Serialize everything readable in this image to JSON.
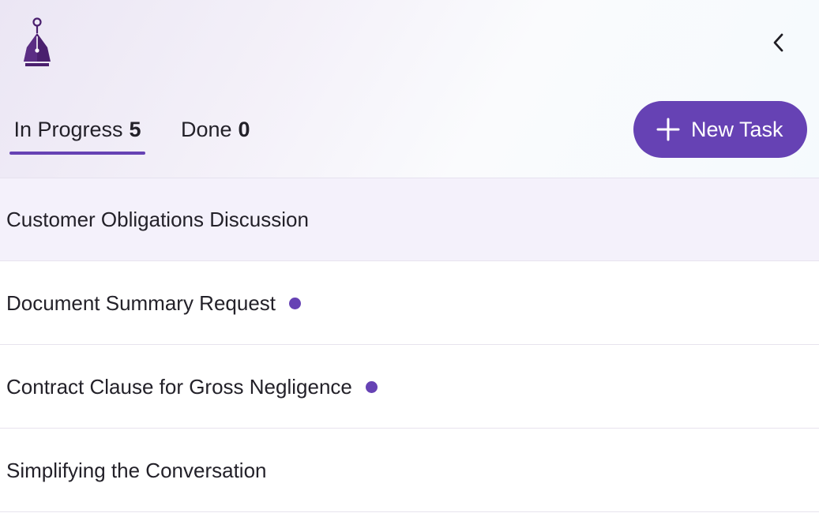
{
  "colors": {
    "accent": "#6642b4",
    "selected_row_bg": "#f4f1fb",
    "logo_primary": "#4a1f6e"
  },
  "header": {
    "logo_icon": "fountain-pen-nib-icon",
    "back_icon": "chevron-left-icon"
  },
  "tabs": [
    {
      "label": "In Progress",
      "count": "5",
      "active": true
    },
    {
      "label": "Done",
      "count": "0",
      "active": false
    }
  ],
  "new_task_button": {
    "icon": "plus-icon",
    "label": "New Task"
  },
  "tasks": [
    {
      "title": "Customer Obligations Discussion",
      "selected": true,
      "unread": false
    },
    {
      "title": "Document Summary Request",
      "selected": false,
      "unread": true
    },
    {
      "title": "Contract Clause for Gross Negligence",
      "selected": false,
      "unread": true
    },
    {
      "title": "Simplifying the Conversation",
      "selected": false,
      "unread": false
    }
  ]
}
